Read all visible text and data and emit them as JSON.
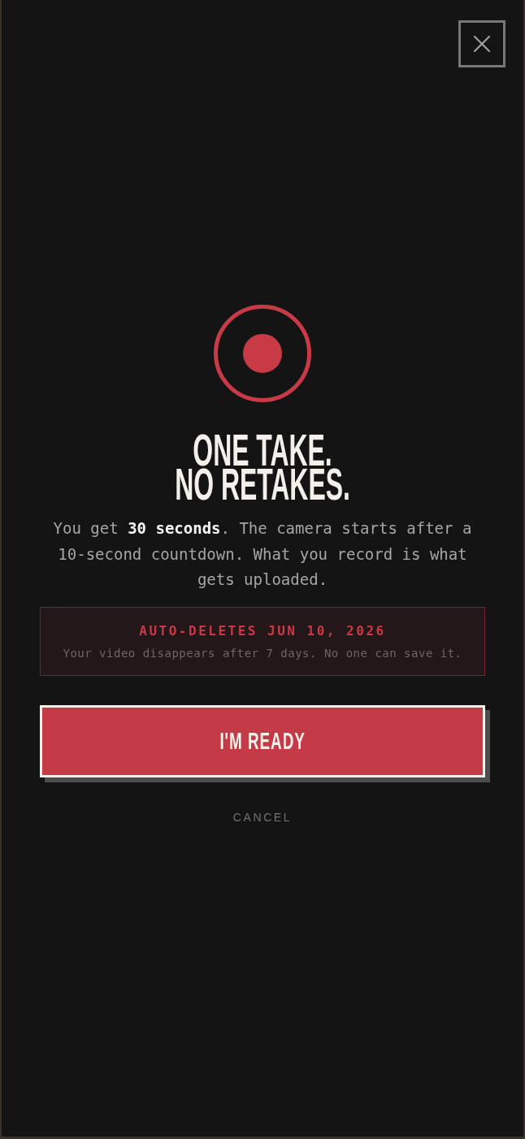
{
  "title": "ONE TAKE. NO RETAKES.",
  "description": "You get **30 seconds**. The camera starts after a 10-second countdown. What you record is what gets uploaded.",
  "notice": {
    "title": "AUTO-DELETES JUN 10, 2026",
    "text": "Your video disappears after 7 days. No one can save it."
  },
  "primary_button": {
    "label": "I'M READY"
  },
  "cancel_button": {
    "label": "CANCEL"
  }
}
